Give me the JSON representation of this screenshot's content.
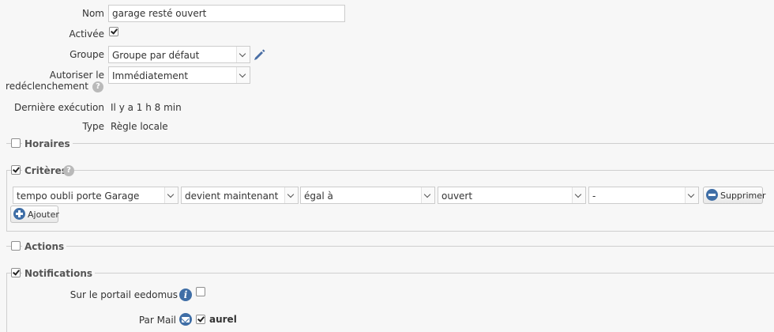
{
  "form": {
    "nom_label": "Nom",
    "nom_value": "garage resté ouvert",
    "activee_label": "Activée",
    "activee_checked": true,
    "groupe_label": "Groupe",
    "groupe_value": "Groupe par défaut",
    "redeclenchement_label_1": "Autoriser le",
    "redeclenchement_label_2": "redéclenchement",
    "redeclenchement_value": "Immédiatement",
    "derniere_label": "Dernière exécution",
    "derniere_value": "Il y a 1 h 8 min",
    "type_label": "Type",
    "type_value": "Règle locale"
  },
  "sections": {
    "horaires": {
      "title": "Horaires",
      "checked": false
    },
    "criteres": {
      "title": "Critères",
      "checked": true
    },
    "actions": {
      "title": "Actions",
      "checked": false
    },
    "notifications": {
      "title": "Notifications",
      "checked": true
    }
  },
  "criterion": {
    "device": "tempo oubli porte Garage",
    "when": "devient maintenant",
    "operator": "égal à",
    "value": "ouvert",
    "extra": "-",
    "delete_label": "Supprimer"
  },
  "add_label": "Ajouter",
  "notifications": {
    "portal_label": "Sur le portail eedomus",
    "portal_checked": false,
    "mail_label": "Par Mail",
    "mail_checked": true,
    "mail_user": "aurel"
  },
  "icons": {
    "help": "question-mark-icon",
    "edit": "pencil-icon",
    "info": "info-icon",
    "mail": "mail-icon",
    "accent": "#3f6ea6"
  }
}
